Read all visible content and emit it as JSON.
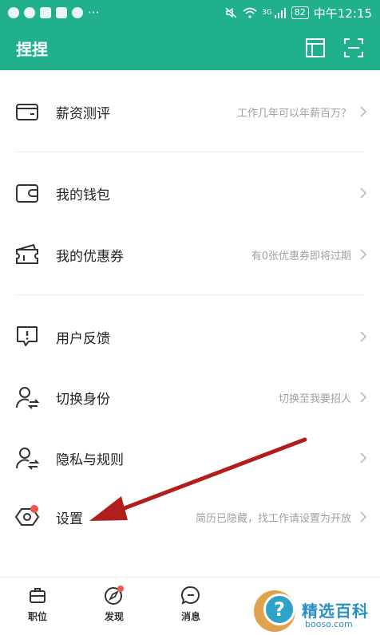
{
  "status_bar": {
    "time": "中午12:15",
    "battery": "82",
    "network": "3G",
    "more": "···"
  },
  "appbar": {
    "title": "捏捏",
    "icons": [
      "layout-icon",
      "scan-icon"
    ]
  },
  "menu": {
    "items": [
      {
        "name": "salary-evaluation",
        "label": "薪资测评",
        "desc": "工作几年可以年薪百万？",
        "icon": "card-icon"
      },
      {
        "name": "my-wallet",
        "label": "我的钱包",
        "desc": "",
        "icon": "wallet-icon"
      },
      {
        "name": "my-coupons",
        "label": "我的优惠券",
        "desc": "有0张优惠券即将过期",
        "icon": "coupon-icon"
      },
      {
        "name": "user-feedback",
        "label": "用户反馈",
        "desc": "",
        "icon": "feedback-icon"
      },
      {
        "name": "switch-identity",
        "label": "切换身份",
        "desc": "切换至我要招人",
        "icon": "switch-user-icon"
      },
      {
        "name": "privacy-rules",
        "label": "隐私与规则",
        "desc": "",
        "icon": "privacy-user-icon"
      },
      {
        "name": "settings",
        "label": "设置",
        "desc": "简历已隐藏，找工作请设置为开放",
        "icon": "gear-icon"
      }
    ]
  },
  "tabbar": {
    "tabs": [
      {
        "label": "职位",
        "icon": "briefcase-icon"
      },
      {
        "label": "发现",
        "icon": "compass-icon"
      },
      {
        "label": "消息",
        "icon": "chat-icon"
      }
    ]
  },
  "watermark": {
    "title": "精选百科",
    "sub": "booso.com"
  },
  "colors": {
    "brand": "#20b18c",
    "badge": "#f0564a",
    "arrow": "#b01e1e"
  }
}
